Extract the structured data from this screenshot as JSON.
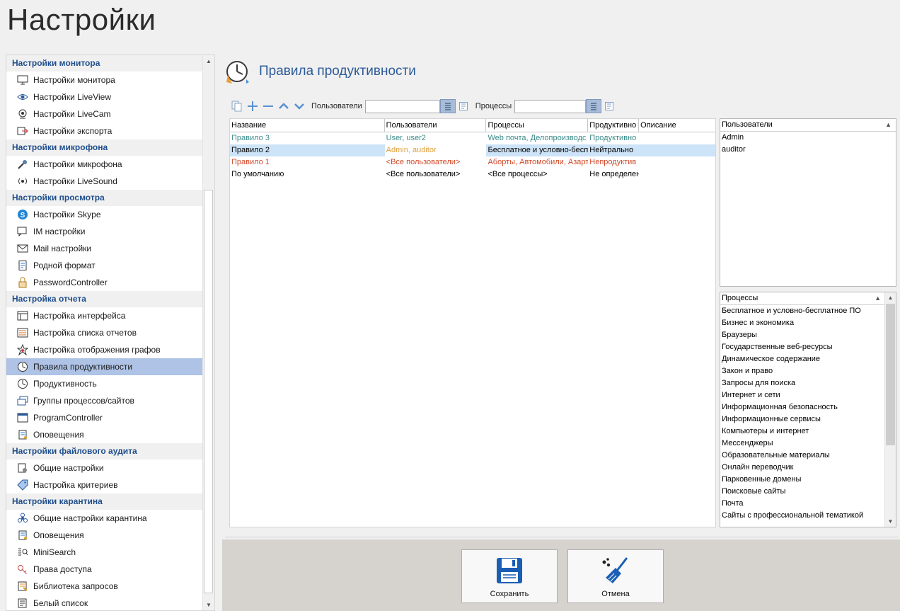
{
  "app": {
    "title": "Настройки"
  },
  "sidebar": {
    "groups": [
      {
        "header": "Настройки монитора",
        "items": [
          {
            "label": "Настройки монитора",
            "icon": "monitor-icon"
          },
          {
            "label": "Настройки LiveView",
            "icon": "eye-icon"
          },
          {
            "label": "Настройки LiveCam",
            "icon": "webcam-icon"
          },
          {
            "label": "Настройки экспорта",
            "icon": "export-icon"
          }
        ]
      },
      {
        "header": "Настройки микрофона",
        "items": [
          {
            "label": "Настройки микрофона",
            "icon": "microphone-icon"
          },
          {
            "label": "Настройки LiveSound",
            "icon": "broadcast-icon"
          }
        ]
      },
      {
        "header": "Настройки просмотра",
        "items": [
          {
            "label": "Настройки Skype",
            "icon": "skype-icon"
          },
          {
            "label": "IM настройки",
            "icon": "chat-icon"
          },
          {
            "label": "Mail настройки",
            "icon": "mail-icon"
          },
          {
            "label": "Родной формат",
            "icon": "document-icon"
          },
          {
            "label": "PasswordController",
            "icon": "lock-icon"
          }
        ]
      },
      {
        "header": "Настройка отчета",
        "items": [
          {
            "label": "Настройка интерфейса",
            "icon": "window-icon"
          },
          {
            "label": "Настройка списка отчетов",
            "icon": "list-icon"
          },
          {
            "label": "Настройка отображения графов",
            "icon": "graph-icon"
          },
          {
            "label": "Правила продуктивности",
            "icon": "clock-icon",
            "active": true
          },
          {
            "label": "Продуктивность",
            "icon": "clock-icon"
          },
          {
            "label": "Группы процессов/сайтов",
            "icon": "windows-group-icon"
          },
          {
            "label": "ProgramController",
            "icon": "program-icon"
          },
          {
            "label": "Оповещения",
            "icon": "notification-icon"
          }
        ]
      },
      {
        "header": "Настройки файлового аудита",
        "items": [
          {
            "label": "Общие настройки",
            "icon": "settings-doc-icon"
          },
          {
            "label": "Настройка критериев",
            "icon": "tag-icon"
          }
        ]
      },
      {
        "header": "Настройки карантина",
        "items": [
          {
            "label": "Общие настройки карантина",
            "icon": "biohazard-icon"
          },
          {
            "label": "Оповещения",
            "icon": "notification-icon"
          },
          {
            "label": "MiniSearch",
            "icon": "search-icon"
          },
          {
            "label": "Права доступа",
            "icon": "key-icon"
          },
          {
            "label": "Библиотека запросов",
            "icon": "library-icon"
          },
          {
            "label": "Белый список",
            "icon": "whitelist-icon"
          }
        ]
      }
    ]
  },
  "main": {
    "title": "Правила продуктивности",
    "toolbar": {
      "users_label": "Пользователи",
      "users_value": "",
      "processes_label": "Процессы",
      "processes_value": ""
    },
    "grid": {
      "columns": [
        "Название",
        "Пользователи",
        "Процессы",
        "Продуктивно",
        "Описание"
      ],
      "rows": [
        {
          "name": "Правило 3",
          "users": "User, user2",
          "processes": "Web почта, Делопроизводс",
          "productivity": "Продуктивно",
          "description": "",
          "color": "#3b8a8a"
        },
        {
          "name": "Правило 2",
          "users": "Admin, auditor",
          "processes": "Бесплатное и условно-бесп",
          "productivity": "Нейтрально",
          "description": "",
          "color": "#000000",
          "users_color": "#e0a040",
          "selected": true
        },
        {
          "name": "Правило 1",
          "users": "<Все пользователи>",
          "processes": "Аборты, Автомобили, Азарт",
          "productivity": "Непродуктив",
          "description": "",
          "color": "#d04a2a"
        },
        {
          "name": "По умолчанию",
          "users": "<Все пользователи>",
          "processes": "<Все процессы>",
          "productivity": "Не определен",
          "description": "",
          "color": "#000000"
        }
      ]
    },
    "users_panel": {
      "header": "Пользователи",
      "items": [
        "Admin",
        "auditor"
      ]
    },
    "processes_panel": {
      "header": "Процессы",
      "items": [
        "Бесплатное и условно-бесплатное ПО",
        "Бизнес и экономика",
        "Браузеры",
        "Государственные веб-ресурсы",
        "Динамическое содержание",
        "Закон и право",
        "Запросы для поиска",
        "Интернет и сети",
        "Информационная безопасность",
        "Информационные сервисы",
        "Компьютеры и интернет",
        "Мессенджеры",
        "Образовательные материалы",
        "Онлайн переводчик",
        "Парковенные домены",
        "Поисковые сайты",
        "Почта",
        "Сайты с профессиональной тематикой"
      ]
    },
    "actions": {
      "save_label": "Сохранить",
      "cancel_label": "Отмена"
    }
  },
  "colors": {
    "accent": "#2d5b98",
    "selection": "#aec3e6",
    "group_header": "#1f4e8c"
  }
}
